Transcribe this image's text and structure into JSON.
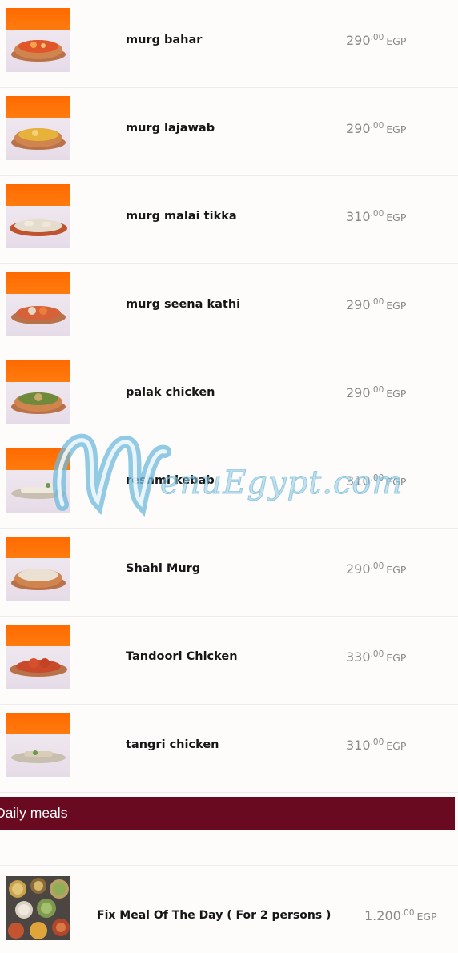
{
  "menu_items": [
    {
      "name": "murg bahar",
      "price_int": "290",
      "price_dec": ".00",
      "currency": "EGP",
      "dish": "curry-red"
    },
    {
      "name": "murg lajawab",
      "price_int": "290",
      "price_dec": ".00",
      "currency": "EGP",
      "dish": "curry-yellow"
    },
    {
      "name": "murg malai tikka",
      "price_int": "310",
      "price_dec": ".00",
      "currency": "EGP",
      "dish": "tikka-white"
    },
    {
      "name": "murg seena kathi",
      "price_int": "290",
      "price_dec": ".00",
      "currency": "EGP",
      "dish": "skewer-mixed"
    },
    {
      "name": "palak chicken",
      "price_int": "290",
      "price_dec": ".00",
      "currency": "EGP",
      "dish": "curry-green"
    },
    {
      "name": "reshmi kebab",
      "price_int": "310",
      "price_dec": ".00",
      "currency": "EGP",
      "dish": "kebab-white"
    },
    {
      "name": "Shahi Murg",
      "price_int": "290",
      "price_dec": ".00",
      "currency": "EGP",
      "dish": "curry-cream"
    },
    {
      "name": "Tandoori Chicken",
      "price_int": "330",
      "price_dec": ".00",
      "currency": "EGP",
      "dish": "tandoori-red"
    },
    {
      "name": "tangri chicken",
      "price_int": "310",
      "price_dec": ".00",
      "currency": "EGP",
      "dish": "drumstick"
    }
  ],
  "section": {
    "title": "Daily meals"
  },
  "meal": {
    "name": "Fix Meal Of The Day ( For 2 persons )",
    "price_int": "1.200",
    "price_dec": ".00",
    "currency": "EGP"
  },
  "watermark": {
    "text": "enuEgypt.com"
  },
  "colors": {
    "accent": "#b8323f",
    "section_bg": "#6a0a20",
    "thumb_orange": "#ff6a00",
    "price_text": "#8a8a8a"
  }
}
